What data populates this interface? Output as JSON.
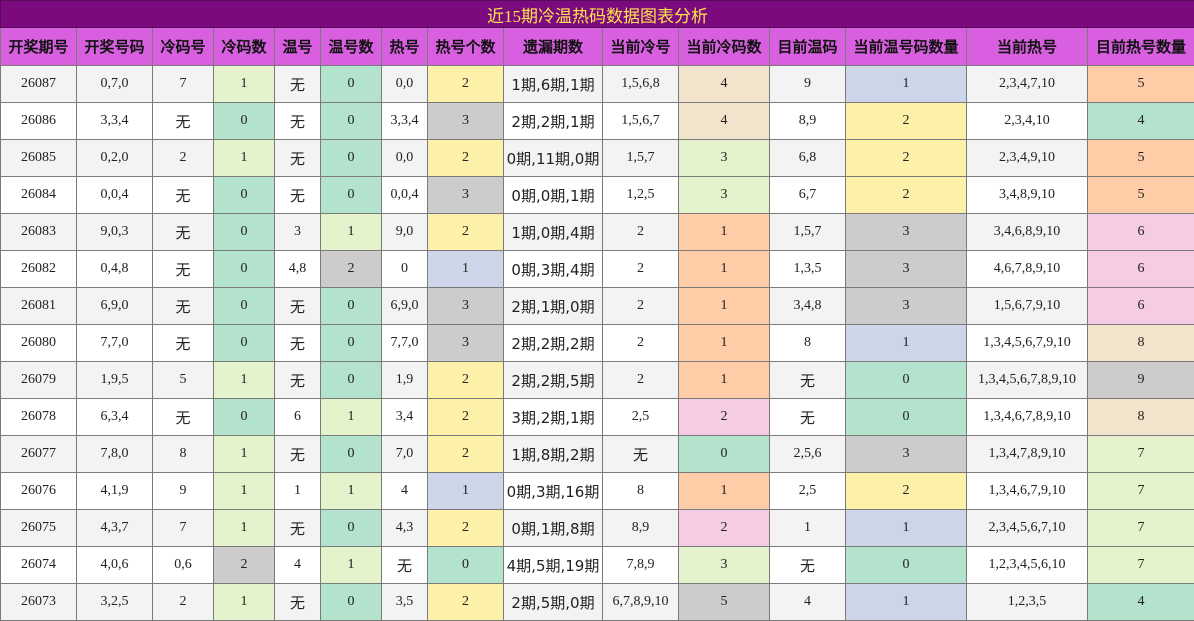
{
  "title": "近15期冷温热码数据图表分析",
  "headers": [
    "开奖期号",
    "开奖号码",
    "冷码号",
    "冷码数",
    "温号",
    "温号数",
    "热号",
    "热号个数",
    "遗漏期数",
    "当前冷号",
    "当前冷码数",
    "目前温码",
    "当前温号码数量",
    "当前热号",
    "目前热号数量"
  ],
  "rows": [
    {
      "issue": "26087",
      "draw": "0,7,0",
      "cold": "7",
      "cold_n": "1",
      "warm": "无",
      "warm_n": "0",
      "hot": "0,0",
      "hot_n": "2",
      "miss": "1期,6期,1期",
      "cur_cold": "1,5,6,8",
      "cur_cold_n": "4",
      "cur_warm": "9",
      "cur_warm_n": "1",
      "cur_hot": "2,3,4,7,10",
      "cur_hot_n": "5"
    },
    {
      "issue": "26086",
      "draw": "3,3,4",
      "cold": "无",
      "cold_n": "0",
      "warm": "无",
      "warm_n": "0",
      "hot": "3,3,4",
      "hot_n": "3",
      "miss": "2期,2期,1期",
      "cur_cold": "1,5,6,7",
      "cur_cold_n": "4",
      "cur_warm": "8,9",
      "cur_warm_n": "2",
      "cur_hot": "2,3,4,10",
      "cur_hot_n": "4"
    },
    {
      "issue": "26085",
      "draw": "0,2,0",
      "cold": "2",
      "cold_n": "1",
      "warm": "无",
      "warm_n": "0",
      "hot": "0,0",
      "hot_n": "2",
      "miss": "0期,11期,0期",
      "cur_cold": "1,5,7",
      "cur_cold_n": "3",
      "cur_warm": "6,8",
      "cur_warm_n": "2",
      "cur_hot": "2,3,4,9,10",
      "cur_hot_n": "5"
    },
    {
      "issue": "26084",
      "draw": "0,0,4",
      "cold": "无",
      "cold_n": "0",
      "warm": "无",
      "warm_n": "0",
      "hot": "0,0,4",
      "hot_n": "3",
      "miss": "0期,0期,1期",
      "cur_cold": "1,2,5",
      "cur_cold_n": "3",
      "cur_warm": "6,7",
      "cur_warm_n": "2",
      "cur_hot": "3,4,8,9,10",
      "cur_hot_n": "5"
    },
    {
      "issue": "26083",
      "draw": "9,0,3",
      "cold": "无",
      "cold_n": "0",
      "warm": "3",
      "warm_n": "1",
      "hot": "9,0",
      "hot_n": "2",
      "miss": "1期,0期,4期",
      "cur_cold": "2",
      "cur_cold_n": "1",
      "cur_warm": "1,5,7",
      "cur_warm_n": "3",
      "cur_hot": "3,4,6,8,9,10",
      "cur_hot_n": "6"
    },
    {
      "issue": "26082",
      "draw": "0,4,8",
      "cold": "无",
      "cold_n": "0",
      "warm": "4,8",
      "warm_n": "2",
      "hot": "0",
      "hot_n": "1",
      "miss": "0期,3期,4期",
      "cur_cold": "2",
      "cur_cold_n": "1",
      "cur_warm": "1,3,5",
      "cur_warm_n": "3",
      "cur_hot": "4,6,7,8,9,10",
      "cur_hot_n": "6"
    },
    {
      "issue": "26081",
      "draw": "6,9,0",
      "cold": "无",
      "cold_n": "0",
      "warm": "无",
      "warm_n": "0",
      "hot": "6,9,0",
      "hot_n": "3",
      "miss": "2期,1期,0期",
      "cur_cold": "2",
      "cur_cold_n": "1",
      "cur_warm": "3,4,8",
      "cur_warm_n": "3",
      "cur_hot": "1,5,6,7,9,10",
      "cur_hot_n": "6"
    },
    {
      "issue": "26080",
      "draw": "7,7,0",
      "cold": "无",
      "cold_n": "0",
      "warm": "无",
      "warm_n": "0",
      "hot": "7,7,0",
      "hot_n": "3",
      "miss": "2期,2期,2期",
      "cur_cold": "2",
      "cur_cold_n": "1",
      "cur_warm": "8",
      "cur_warm_n": "1",
      "cur_hot": "1,3,4,5,6,7,9,10",
      "cur_hot_n": "8"
    },
    {
      "issue": "26079",
      "draw": "1,9,5",
      "cold": "5",
      "cold_n": "1",
      "warm": "无",
      "warm_n": "0",
      "hot": "1,9",
      "hot_n": "2",
      "miss": "2期,2期,5期",
      "cur_cold": "2",
      "cur_cold_n": "1",
      "cur_warm": "无",
      "cur_warm_n": "0",
      "cur_hot": "1,3,4,5,6,7,8,9,10",
      "cur_hot_n": "9"
    },
    {
      "issue": "26078",
      "draw": "6,3,4",
      "cold": "无",
      "cold_n": "0",
      "warm": "6",
      "warm_n": "1",
      "hot": "3,4",
      "hot_n": "2",
      "miss": "3期,2期,1期",
      "cur_cold": "2,5",
      "cur_cold_n": "2",
      "cur_warm": "无",
      "cur_warm_n": "0",
      "cur_hot": "1,3,4,6,7,8,9,10",
      "cur_hot_n": "8"
    },
    {
      "issue": "26077",
      "draw": "7,8,0",
      "cold": "8",
      "cold_n": "1",
      "warm": "无",
      "warm_n": "0",
      "hot": "7,0",
      "hot_n": "2",
      "miss": "1期,8期,2期",
      "cur_cold": "无",
      "cur_cold_n": "0",
      "cur_warm": "2,5,6",
      "cur_warm_n": "3",
      "cur_hot": "1,3,4,7,8,9,10",
      "cur_hot_n": "7"
    },
    {
      "issue": "26076",
      "draw": "4,1,9",
      "cold": "9",
      "cold_n": "1",
      "warm": "1",
      "warm_n": "1",
      "hot": "4",
      "hot_n": "1",
      "miss": "0期,3期,16期",
      "cur_cold": "8",
      "cur_cold_n": "1",
      "cur_warm": "2,5",
      "cur_warm_n": "2",
      "cur_hot": "1,3,4,6,7,9,10",
      "cur_hot_n": "7"
    },
    {
      "issue": "26075",
      "draw": "4,3,7",
      "cold": "7",
      "cold_n": "1",
      "warm": "无",
      "warm_n": "0",
      "hot": "4,3",
      "hot_n": "2",
      "miss": "0期,1期,8期",
      "cur_cold": "8,9",
      "cur_cold_n": "2",
      "cur_warm": "1",
      "cur_warm_n": "1",
      "cur_hot": "2,3,4,5,6,7,10",
      "cur_hot_n": "7"
    },
    {
      "issue": "26074",
      "draw": "4,0,6",
      "cold": "0,6",
      "cold_n": "2",
      "warm": "4",
      "warm_n": "1",
      "hot": "无",
      "hot_n": "0",
      "miss": "4期,5期,19期",
      "cur_cold": "7,8,9",
      "cur_cold_n": "3",
      "cur_warm": "无",
      "cur_warm_n": "0",
      "cur_hot": "1,2,3,4,5,6,10",
      "cur_hot_n": "7"
    },
    {
      "issue": "26073",
      "draw": "3,2,5",
      "cold": "2",
      "cold_n": "1",
      "warm": "无",
      "warm_n": "0",
      "hot": "3,5",
      "hot_n": "2",
      "miss": "2期,5期,0期",
      "cur_cold": "6,7,8,9,10",
      "cur_cold_n": "5",
      "cur_warm": "4",
      "cur_warm_n": "1",
      "cur_hot": "1,2,3,5",
      "cur_hot_n": "4"
    }
  ]
}
